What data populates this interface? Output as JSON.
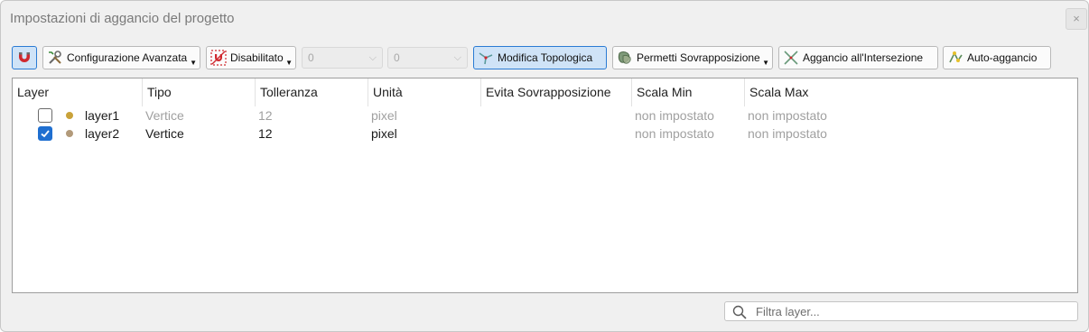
{
  "window": {
    "title": "Impostazioni di aggancio del progetto",
    "close_glyph": "×"
  },
  "toolbar": {
    "snapping_toggle": {
      "icon": "magnet-icon",
      "active": true
    },
    "advanced_config": {
      "label": "Configurazione Avanzata",
      "icon": "tools-icon"
    },
    "snapping_type": {
      "label": "Disabilitato",
      "icon": "snap-disabled-icon"
    },
    "tolerance": {
      "value": "0"
    },
    "units": {
      "value": "0"
    },
    "topological_editing": {
      "label": "Modifica Topologica",
      "icon": "topology-icon",
      "active": true
    },
    "overlap": {
      "label": "Permetti Sovrapposizione",
      "icon": "overlap-icon"
    },
    "intersection": {
      "label": "Aggancio all'Intersezione",
      "icon": "intersection-icon"
    },
    "self_snapping": {
      "label": "Auto-aggancio",
      "icon": "self-snap-icon"
    }
  },
  "table": {
    "columns": [
      "Layer",
      "Tipo",
      "Tolleranza",
      "Unità",
      "Evita Sovrapposizione",
      "Scala Min",
      "Scala Max"
    ],
    "rows": [
      {
        "checked": false,
        "layer": "layer1",
        "tipo": "Vertice",
        "tolleranza": "12",
        "unita": "pixel",
        "scala_min": "non impostato",
        "scala_max": "non impostato",
        "dot_color": "#c9a23a"
      },
      {
        "checked": true,
        "layer": "layer2",
        "tipo": "Vertice",
        "tolleranza": "12",
        "unita": "pixel",
        "scala_min": "non impostato",
        "scala_max": "non impostato",
        "dot_color": "#b29a7a"
      }
    ]
  },
  "search": {
    "placeholder": "Filtra layer..."
  }
}
